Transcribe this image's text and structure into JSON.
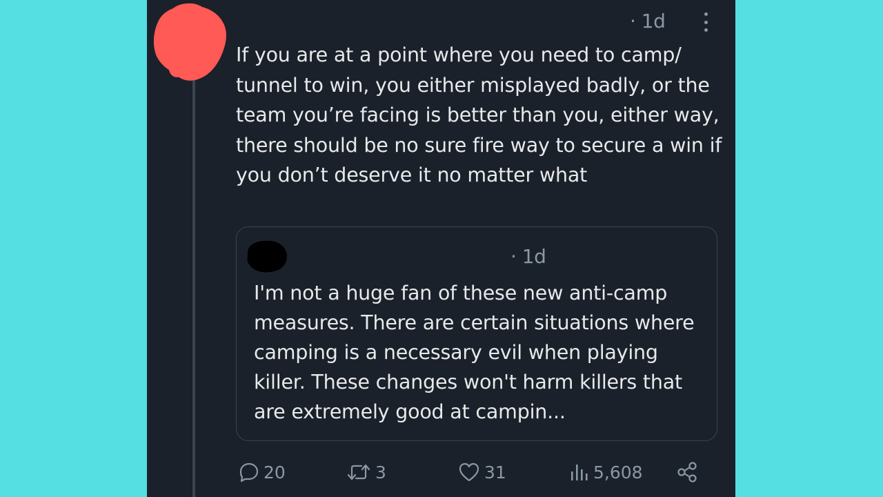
{
  "tweet": {
    "time": "· 1d",
    "text": "If you are at a point where you need to camp/ tunnel to win, you either misplayed badly, or the team you’re facing is better than you, either way, there should be no sure fire way to secure a win if you don’t deserve it no matter what"
  },
  "quote": {
    "time": "· 1d",
    "text": "I'm not a huge fan of these new anti-camp measures. There are certain situations where camping is a necessary evil when playing killer. These changes won't harm killers that are extremely good at campin..."
  },
  "actions": {
    "replies": "20",
    "retweets": "3",
    "likes": "31",
    "views": "5,608"
  },
  "icons": {
    "reply": "reply-icon",
    "retweet": "retweet-icon",
    "like": "heart-icon",
    "views": "views-icon",
    "share": "share-icon",
    "more": "more-icon"
  },
  "colors": {
    "background": "#55dfe3",
    "panel": "#1b212b",
    "text": "#e7e9ea",
    "secondary": "#8b98a5",
    "redaction_red": "#ff5a55",
    "redaction_black": "#000000"
  }
}
